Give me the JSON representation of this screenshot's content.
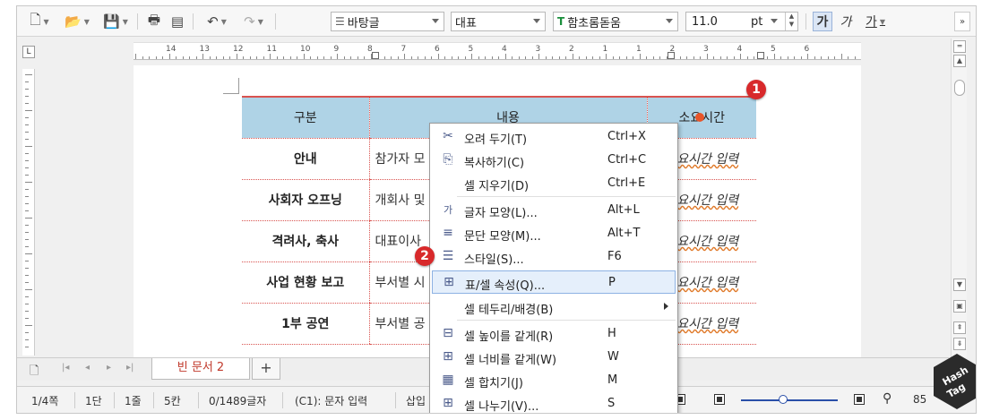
{
  "toolbar": {
    "style_combo": "바탕글",
    "lang_combo": "대표",
    "font_combo": "함초롬돋움",
    "size_value": "11.0",
    "size_unit": "pt",
    "bold_label": "가",
    "italic_label": "가",
    "underline_label": "가"
  },
  "ruler": {
    "numbers": [
      "14",
      "13",
      "12",
      "11",
      "10",
      "9",
      "8",
      "7",
      "6",
      "5",
      "4",
      "3",
      "2",
      "1",
      "1",
      "2",
      "3",
      "4",
      "5",
      "6"
    ]
  },
  "table": {
    "headers": [
      "구분",
      "내용",
      "소요시간"
    ],
    "rows": [
      {
        "c1": "안내",
        "c2": "참가자 모",
        "c3": "소요시간 입력"
      },
      {
        "c1": "사회자 오프닝",
        "c2": "개회사 및",
        "c3": "소요시간 입력"
      },
      {
        "c1": "격려사, 축사",
        "c2": "대표이사",
        "c3": "소요시간 입력"
      },
      {
        "c1": "사업 현황 보고",
        "c2": "부서별 시",
        "c3": "소요시간 입력"
      },
      {
        "c1": "1부 공연",
        "c2": "부서별 공",
        "c3": "소요시간 입력"
      }
    ]
  },
  "badges": {
    "one": "1",
    "two": "2"
  },
  "context_menu": {
    "items": [
      {
        "label": "오려 두기(T)",
        "shortcut": "Ctrl+X"
      },
      {
        "label": "복사하기(C)",
        "shortcut": "Ctrl+C"
      },
      {
        "label": "셀 지우기(D)",
        "shortcut": "Ctrl+E"
      },
      {
        "label": "글자 모양(L)...",
        "shortcut": "Alt+L"
      },
      {
        "label": "문단 모양(M)...",
        "shortcut": "Alt+T"
      },
      {
        "label": "스타일(S)...",
        "shortcut": "F6"
      },
      {
        "label": "표/셀 속성(Q)...",
        "shortcut": "P"
      },
      {
        "label": "셀 테두리/배경(B)",
        "shortcut": ""
      },
      {
        "label": "셀 높이를 같게(R)",
        "shortcut": "H"
      },
      {
        "label": "셀 너비를 같게(W)",
        "shortcut": "W"
      },
      {
        "label": "셀 합치기(J)",
        "shortcut": "M"
      },
      {
        "label": "셀 나누기(V)...",
        "shortcut": "S"
      }
    ]
  },
  "tabs": {
    "active": "빈 문서 2",
    "add": "+"
  },
  "status": {
    "page": "1/4쪽",
    "section": "1단",
    "line": "1줄",
    "column": "5칸",
    "chars": "0/1489글자",
    "cell": "(C1): 문자 입력",
    "mode": "삽입",
    "zoom": "85"
  },
  "logo": {
    "text1": "Hash",
    "text2": "Tag"
  },
  "colors": {
    "header_fill": "#afd3e6",
    "table_line": "#d9534f",
    "badge": "#d8292b",
    "menu_select": "#e5effb"
  }
}
